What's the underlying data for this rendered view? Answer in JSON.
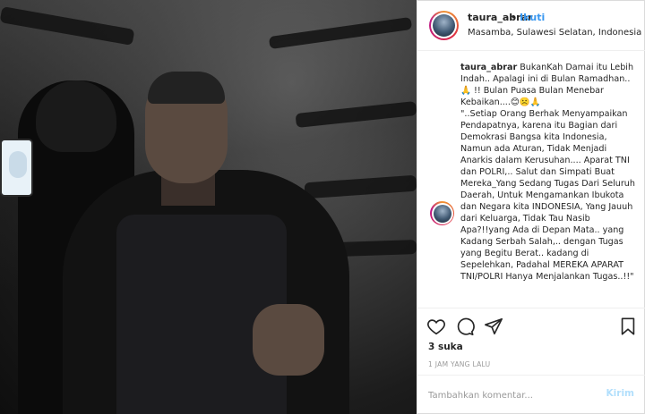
{
  "post": {
    "username": "taura_abrar",
    "separator": "•",
    "follow_label": "Ikuti",
    "location": "Masamba, Sulawesi Selatan, Indonesia"
  },
  "comment": {
    "username": "taura_abrar",
    "text": " BukanKah Damai itu Lebih Indah.. Apalagi ini di Bulan Ramadhan..🙏 !! Bulan Puasa Bulan Menebar Kebaikan....😊☹️🙏\n\"..Setiap Orang Berhak Menyampaikan Pendapatnya, karena itu Bagian dari Demokrasi Bangsa kita Indonesia, Namun ada Aturan, Tidak Menjadi Anarkis dalam Kerusuhan.... Aparat TNI dan POLRI,.. Salut dan Simpati Buat Mereka_Yang Sedang Tugas Dari Seluruh Daerah, Untuk Mengamankan Ibukota dan Negara kita INDONESIA, Yang Jauuh dari Keluarga, Tidak Tau Nasib Apa?!!yang Ada di Depan Mata.. yang Kadang Serbah Salah,.. dengan Tugas yang Begitu Berat.. kadang di Sepelehkan, Padahal MEREKA APARAT TNI/POLRI Hanya Menjalankan Tugas..!!\""
  },
  "icons": {
    "like": "heart-icon",
    "comment": "comment-icon",
    "share": "share-icon",
    "save": "bookmark-icon"
  },
  "stats": {
    "likes": "3 suka",
    "time": "1 JAM YANG LALU"
  },
  "add_comment": {
    "placeholder": "Tambahkan komentar...",
    "send_label": "Kirim"
  },
  "colors": {
    "link_blue": "#3897f0",
    "send_disabled": "#b2dffc",
    "muted_text": "#999999"
  }
}
